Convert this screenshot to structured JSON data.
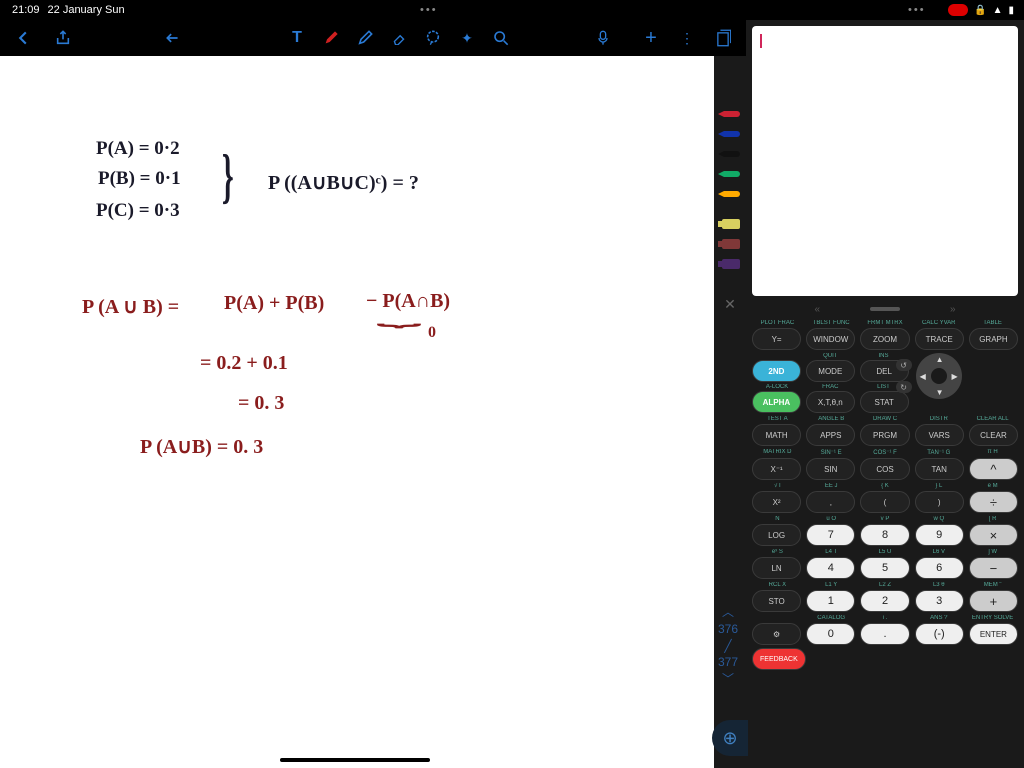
{
  "status": {
    "time": "21:09",
    "date": "22 January Sun",
    "ellipsis": "•••"
  },
  "toolbar": {},
  "sidestrip": {
    "pencils": [
      "#c23",
      "#13a",
      "#111",
      "#1a6",
      "#fa0"
    ],
    "markers": [
      "#d8d060",
      "#803838",
      "#4a2a6a"
    ]
  },
  "notes": {
    "l1": "P(A) = 0·2",
    "l2": "P(B) = 0·1",
    "l3": "P(C) = 0·3",
    "brace": "}",
    "q": "P ((A∪B∪C)ᶜ)  = ?",
    "r1a": "P (A ∪ B)  =",
    "r1b": "P(A)  + P(B)",
    "r1c": "− P(A∩B)",
    "r1u": "⏟",
    "r1z": "0",
    "r2": "=    0.2 + 0.1",
    "r3": "=   0. 3",
    "r4": "P (A∪B) = 0. 3"
  },
  "pageNav": {
    "up": "︿",
    "a": "376",
    "b": "377",
    "down": "﹀"
  },
  "calc": {
    "topHints": [
      "PLOT  FRAC",
      "TBLST FUNC",
      "FRMT  MTRX",
      "CALC  YVAR",
      "TABLE"
    ],
    "topRow": [
      "Y=",
      "WINDOW",
      "ZOOM",
      "TRACE",
      "GRAPH"
    ],
    "h2": [
      "",
      "QUIT",
      "INS",
      "",
      ""
    ],
    "r2": [
      "2ND",
      "MODE",
      "DEL"
    ],
    "h3": [
      "",
      "A-LOCK",
      "FRAC",
      "LIST",
      "",
      ""
    ],
    "r3": [
      "ALPHA",
      "X,T,θ,n",
      "STAT"
    ],
    "h4": [
      "TEST    A",
      "ANGLE  B",
      "DRAW   C",
      "DISTR",
      "CLEAR ALL"
    ],
    "r4": [
      "MATH",
      "APPS",
      "PRGM",
      "VARS",
      "CLEAR"
    ],
    "h5": [
      "MATRIX  D",
      "SIN⁻¹   E",
      "COS⁻¹   F",
      "TAN⁻¹  G",
      "π      H"
    ],
    "r5": [
      "X⁻¹",
      "SIN",
      "COS",
      "TAN",
      "^"
    ],
    "h6": [
      "√      I",
      "EE     J",
      "{      K",
      "}      L",
      "e      M"
    ],
    "r6": [
      "X²",
      ",",
      "(",
      ")",
      "÷"
    ],
    "h7": [
      "        N",
      "u      O",
      "v      P",
      "w     Q",
      "[      R"
    ],
    "r7": [
      "LOG",
      "7",
      "8",
      "9",
      "×"
    ],
    "h8": [
      "eˣ     S",
      "L4     T",
      "L5     U",
      "L6     V",
      "]      W"
    ],
    "r8": [
      "LN",
      "4",
      "5",
      "6",
      "−"
    ],
    "h9": [
      "RCL    X",
      "L1     Y",
      "L2     Z",
      "L3     θ",
      "MEM   \""
    ],
    "r9": [
      "STO",
      "1",
      "2",
      "3",
      "+"
    ],
    "h10": [
      "",
      "CATALOG",
      "i      .",
      "ANS   ?",
      "ENTRY SOLVE"
    ],
    "r10": [
      "FEEDBACK",
      "0",
      ".",
      "(-)",
      "ENTER"
    ],
    "settings": "⚙"
  }
}
